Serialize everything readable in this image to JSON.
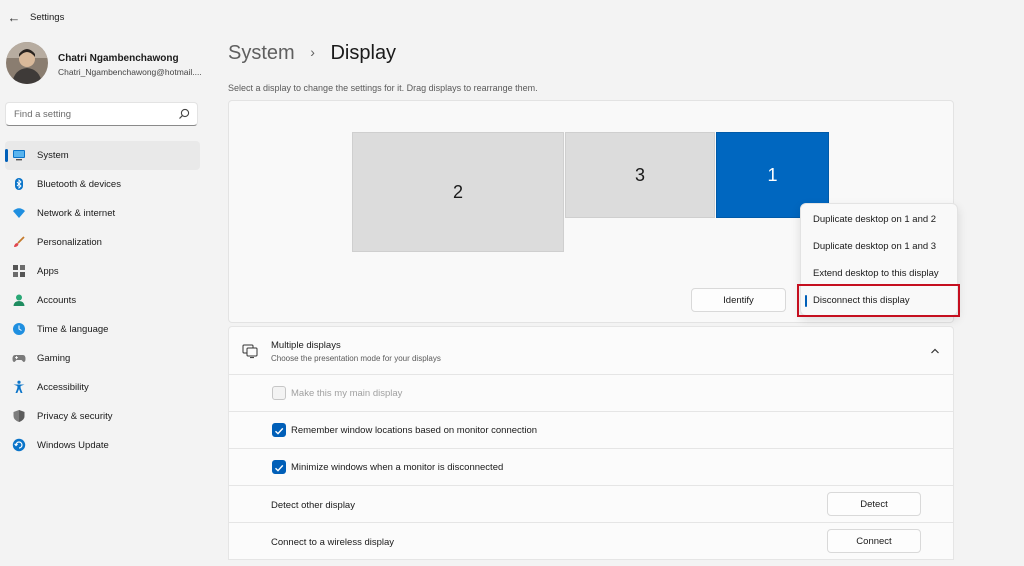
{
  "window": {
    "title": "Settings"
  },
  "user": {
    "name": "Chatri Ngambenchawong",
    "email": "Chatri_Ngambenchawong@hotmail...."
  },
  "search": {
    "placeholder": "Find a setting"
  },
  "sidebar": {
    "items": [
      {
        "label": "System",
        "icon": "monitor-icon",
        "selected": true
      },
      {
        "label": "Bluetooth & devices",
        "icon": "bluetooth-icon"
      },
      {
        "label": "Network & internet",
        "icon": "wifi-icon"
      },
      {
        "label": "Personalization",
        "icon": "brush-icon"
      },
      {
        "label": "Apps",
        "icon": "apps-icon"
      },
      {
        "label": "Accounts",
        "icon": "person-icon"
      },
      {
        "label": "Time & language",
        "icon": "globe-clock-icon"
      },
      {
        "label": "Gaming",
        "icon": "gamepad-icon"
      },
      {
        "label": "Accessibility",
        "icon": "accessibility-icon"
      },
      {
        "label": "Privacy & security",
        "icon": "shield-icon"
      },
      {
        "label": "Windows Update",
        "icon": "update-icon"
      }
    ]
  },
  "page": {
    "breadcrumb_parent": "System",
    "breadcrumb_separator": "›",
    "breadcrumb_current": "Display",
    "instruction": "Select a display to change the settings for it. Drag displays to rearrange them."
  },
  "arrangement": {
    "displays": [
      {
        "number": "2",
        "selected": false
      },
      {
        "number": "3",
        "selected": false
      },
      {
        "number": "1",
        "selected": true
      }
    ],
    "identify_label": "Identify"
  },
  "context_menu": {
    "items": [
      {
        "label": "Duplicate desktop on 1 and 2"
      },
      {
        "label": "Duplicate desktop on 1 and 3"
      },
      {
        "label": "Extend desktop to this display"
      },
      {
        "label": "Disconnect this display",
        "highlighted": true
      }
    ]
  },
  "multiple_displays": {
    "title": "Multiple displays",
    "subtitle": "Choose the presentation mode for your displays",
    "expanded": true,
    "options": [
      {
        "label": "Make this my main display",
        "checked": false,
        "disabled": true
      },
      {
        "label": "Remember window locations based on monitor connection",
        "checked": true,
        "disabled": false
      },
      {
        "label": "Minimize windows when a monitor is disconnected",
        "checked": true,
        "disabled": false
      }
    ],
    "detect": {
      "label": "Detect other display",
      "button": "Detect"
    },
    "wireless": {
      "label": "Connect to a wireless display",
      "button": "Connect"
    }
  },
  "colors": {
    "accent": "#005fb8",
    "selected_display": "#0067c0",
    "highlight_box": "#c50f1f"
  }
}
